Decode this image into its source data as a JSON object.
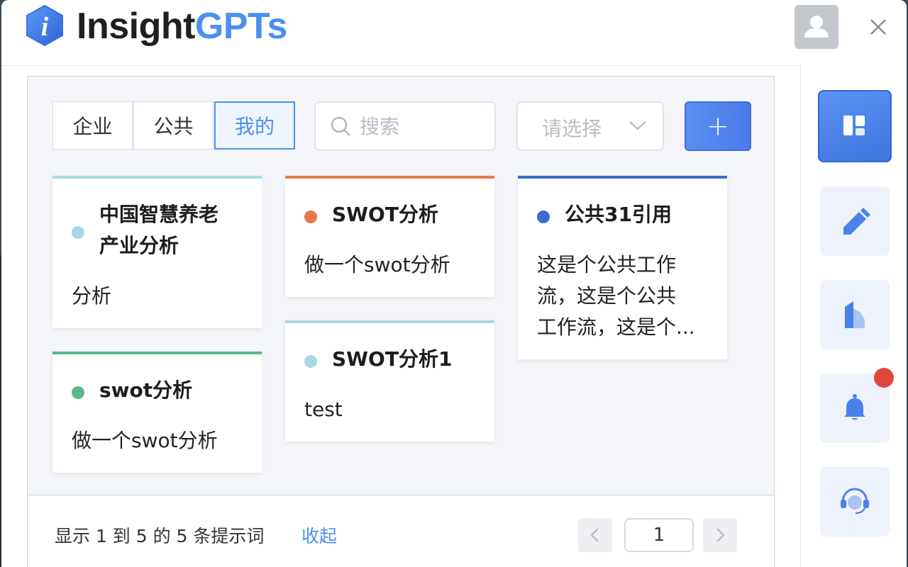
{
  "header": {
    "brand_part1": "Insight",
    "brand_part2": "GPTs",
    "logo_letter": "i"
  },
  "filters": {
    "tabs": [
      {
        "label": "企业",
        "active": false
      },
      {
        "label": "公共",
        "active": false
      },
      {
        "label": "我的",
        "active": true
      }
    ],
    "search_placeholder": "搜索",
    "select_placeholder": "请选择",
    "add_label": "+"
  },
  "cards": [
    {
      "title": "中国智慧养老产业分析",
      "title_line1": "中国智慧养老",
      "title_line2": "产业分析",
      "desc": "分析",
      "color": "#a8d8e8"
    },
    {
      "title": "SWOT分析",
      "desc": "做一个swot分析",
      "color": "#e8784a"
    },
    {
      "title": "公共31引用",
      "desc_line1": "这是个公共工作",
      "desc_line2": "流，这是个公共",
      "desc_line3": "工作流，这是个...",
      "color": "#3d6bd4"
    },
    {
      "title": "swot分析",
      "desc": "做一个swot分析",
      "color": "#5bb88a"
    },
    {
      "title": "SWOT分析1",
      "desc": "test",
      "color": "#a8d8e8"
    }
  ],
  "footer": {
    "summary": "显示 1 到 5 的 5 条提示词",
    "collapse_label": "收起",
    "page": "1"
  },
  "colors": {
    "accent": "#4a90ef",
    "notification_badge": "#e0463a"
  },
  "sidebar_icons": [
    "dashboard-icon",
    "pen-icon",
    "building-icon",
    "bell-icon",
    "support-headset-icon"
  ]
}
